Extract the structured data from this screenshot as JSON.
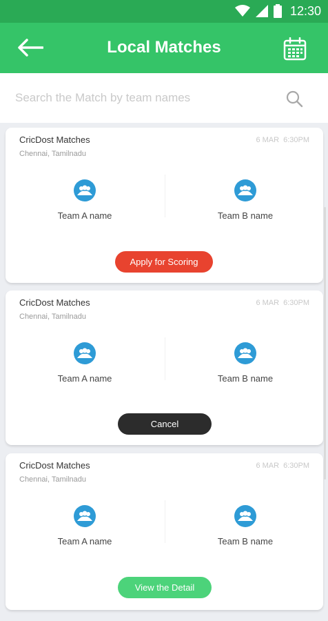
{
  "status_bar": {
    "time": "12:30",
    "icons": [
      "wifi-icon",
      "cell-signal-icon",
      "battery-icon"
    ]
  },
  "header": {
    "title": "Local Matches",
    "back_icon": "arrow-left-icon",
    "calendar_icon": "calendar-icon"
  },
  "search": {
    "placeholder": "Search the Match by team names",
    "value": "",
    "icon": "search-icon"
  },
  "matches": [
    {
      "title": "CricDost Matches",
      "location": "Chennai, Tamilnadu",
      "date": "6 MAR",
      "time": "6:30PM",
      "team_a": "Team A name",
      "team_b": "Team B name",
      "action": {
        "label": "Apply for Scoring",
        "color": "#e8432f"
      }
    },
    {
      "title": "CricDost Matches",
      "location": "Chennai, Tamilnadu",
      "date": "6 MAR",
      "time": "6:30PM",
      "team_a": "Team A name",
      "team_b": "Team B name",
      "action": {
        "label": "Cancel",
        "color": "#2c2c2c"
      }
    },
    {
      "title": "CricDost Matches",
      "location": "Chennai, Tamilnadu",
      "date": "6 MAR",
      "time": "6:30PM",
      "team_a": "Team A name",
      "team_b": "Team B name",
      "action": {
        "label": "View the Detail",
        "color": "#4cd37a"
      }
    }
  ],
  "colors": {
    "status_bar": "#2aaa55",
    "app_bar": "#35c468",
    "team_icon": "#2e9bd6",
    "background": "#eceef2"
  }
}
